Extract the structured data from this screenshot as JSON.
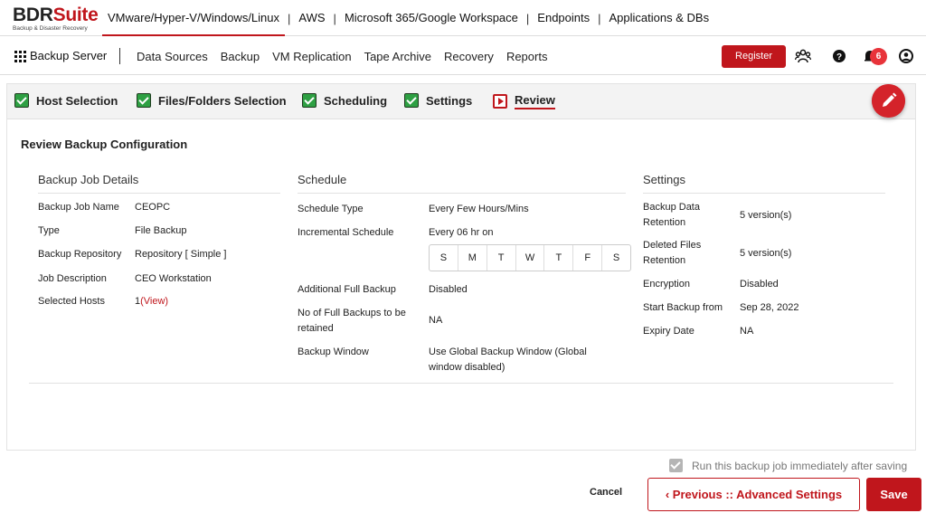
{
  "brand": {
    "name_part1": "BDR",
    "name_part2": "Suite",
    "tagline": "Backup & Disaster Recovery"
  },
  "top_nav": {
    "items": [
      "VMware/Hyper-V/Windows/Linux",
      "AWS",
      "Microsoft 365/Google Workspace",
      "Endpoints",
      "Applications & DBs"
    ],
    "separator": "|",
    "active_index": 0
  },
  "sub_nav": {
    "backup_server": "Backup Server",
    "items": [
      "Data Sources",
      "Backup",
      "VM Replication",
      "Tape Archive",
      "Recovery",
      "Reports"
    ],
    "register_label": "Register",
    "notification_count": "6",
    "icons": [
      "grid-icon",
      "users-icon",
      "help-icon",
      "bell-icon",
      "user-icon"
    ]
  },
  "wizard": {
    "steps": [
      {
        "label": "Host Selection",
        "state": "done"
      },
      {
        "label": "Files/Folders Selection",
        "state": "done"
      },
      {
        "label": "Scheduling",
        "state": "done"
      },
      {
        "label": "Settings",
        "state": "done"
      },
      {
        "label": "Review",
        "state": "current"
      }
    ],
    "edit_icon": "pencil-icon"
  },
  "review": {
    "title": "Review Backup Configuration",
    "job_details": {
      "heading": "Backup Job Details",
      "rows": [
        {
          "label": "Backup Job Name",
          "value": "CEOPC"
        },
        {
          "label": "Type",
          "value": "File Backup"
        },
        {
          "label": "Backup Repository",
          "value": "Repository [ Simple ]"
        },
        {
          "label": "Job Description",
          "value": "CEO Workstation"
        },
        {
          "label": "Selected Hosts",
          "value": "1",
          "link": "(View)"
        }
      ]
    },
    "schedule": {
      "heading": "Schedule",
      "schedule_type_label": "Schedule Type",
      "schedule_type_value": "Every Few Hours/Mins",
      "incremental_label": "Incremental Schedule",
      "incremental_value": "Every 06 hr on",
      "days": [
        "S",
        "M",
        "T",
        "W",
        "T",
        "F",
        "S"
      ],
      "full_backup_label": "Additional Full Backup",
      "full_backup_value": "Disabled",
      "retained_label": "No of Full Backups to be retained",
      "retained_value": "NA",
      "window_label": "Backup Window",
      "window_value": "Use Global Backup Window  (Global window disabled)"
    },
    "settings": {
      "heading": "Settings",
      "rows": [
        {
          "label": "Backup Data Retention",
          "value": "5 version(s)"
        },
        {
          "label": "Deleted Files Retention",
          "value": "5 version(s)"
        },
        {
          "label": "Encryption",
          "value": "Disabled"
        },
        {
          "label": "Start Backup from",
          "value": "Sep 28, 2022"
        },
        {
          "label": "Expiry Date",
          "value": "NA"
        }
      ]
    }
  },
  "footer": {
    "run_immediately_label": "Run this backup job immediately after saving",
    "run_immediately_checked": true,
    "cancel_label": "Cancel",
    "previous_label": "‹ Previous :: Advanced Settings",
    "save_label": "Save"
  },
  "colors": {
    "accent": "#c0161c",
    "check_green": "#2ea043"
  }
}
